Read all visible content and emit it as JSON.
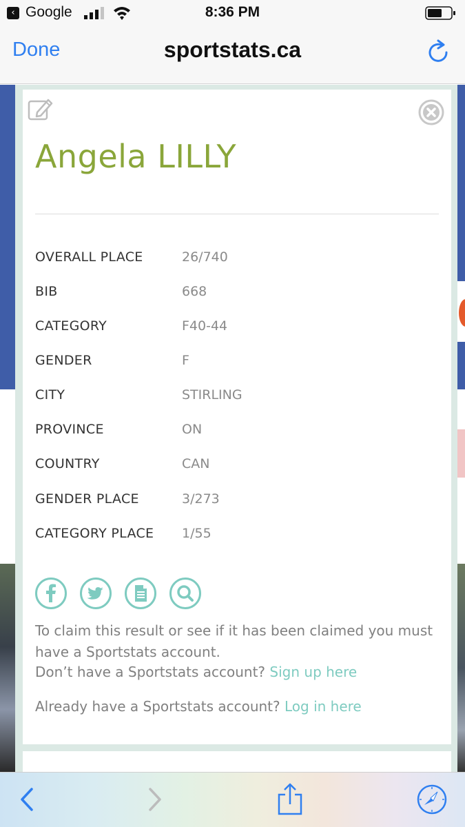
{
  "status_bar": {
    "carrier": "Google",
    "time": "8:36 PM"
  },
  "nav": {
    "done_label": "Done",
    "title": "sportstats.ca"
  },
  "athlete": {
    "name": "Angela LILLY"
  },
  "details": [
    {
      "label": "OVERALL PLACE",
      "value": "26/740"
    },
    {
      "label": "BIB",
      "value": "668"
    },
    {
      "label": "CATEGORY",
      "value": "F40-44"
    },
    {
      "label": "GENDER",
      "value": "F"
    },
    {
      "label": "CITY",
      "value": "STIRLING"
    },
    {
      "label": "PROVINCE",
      "value": "ON"
    },
    {
      "label": "COUNTRY",
      "value": "CAN"
    },
    {
      "label": "GENDER PLACE",
      "value": "3/273"
    },
    {
      "label": "CATEGORY PLACE",
      "value": "1/55"
    }
  ],
  "share": {
    "icons": [
      "facebook-icon",
      "twitter-icon",
      "document-icon",
      "search-icon"
    ]
  },
  "claim": {
    "intro": "To claim this result or see if it has been claimed you must have a Sportstats account.",
    "signup_prompt": "Don’t have a Sportstats account?",
    "signup_link": "Sign up here",
    "login_prompt": "Already have a Sportstats account?",
    "login_link": "Log in here"
  },
  "colors": {
    "accent_blue": "#2f7ff0",
    "name_green": "#8aa63a",
    "teal": "#7ecbc0",
    "site_blue": "#3f5da8"
  }
}
